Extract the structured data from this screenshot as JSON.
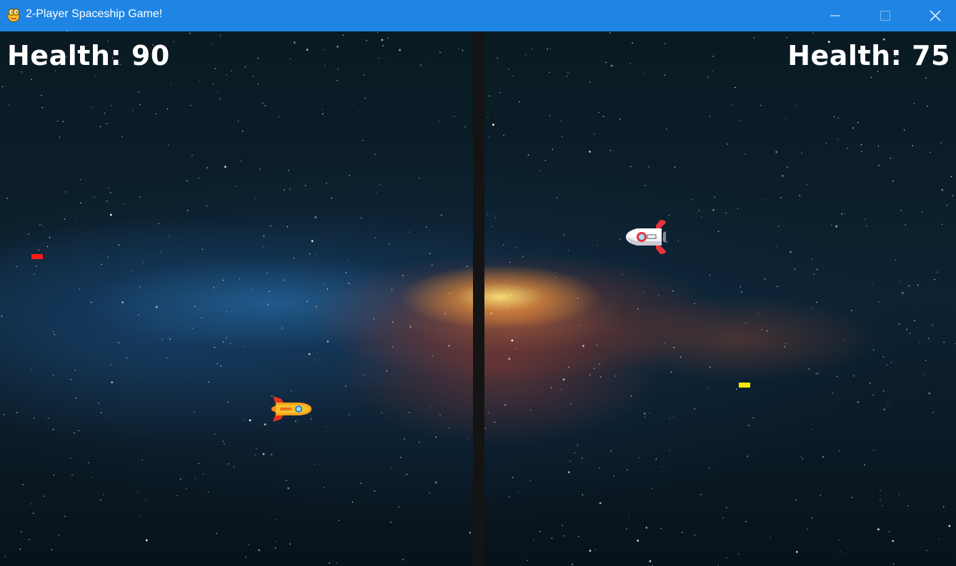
{
  "window": {
    "title": "2-Player Spaceship Game!",
    "app_icon": "pygame-snake-icon",
    "controls": [
      "minimize-icon",
      "maximize-icon",
      "close-icon"
    ]
  },
  "game": {
    "left_player": {
      "health_text": "Health: 90",
      "health": 90,
      "ship_color": "yellow-orange",
      "bullet_color": "#ff1a1a"
    },
    "right_player": {
      "health_text": "Health: 75",
      "health": 75,
      "ship_color": "red-white",
      "bullet_color": "#ffe800"
    },
    "background": "milky-way-galaxy",
    "colors": {
      "titlebar": "#1f85e4",
      "border": "#141414",
      "text": "#ffffff"
    }
  }
}
